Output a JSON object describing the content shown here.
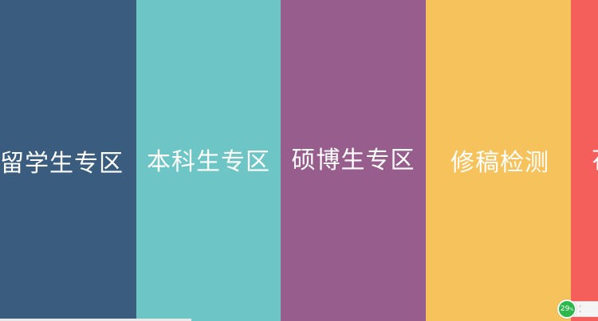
{
  "panels": [
    {
      "label": "留学生专区",
      "color": "#395C7F"
    },
    {
      "label": "本科生专区",
      "color": "#6DC5C5"
    },
    {
      "label": "硕博生专区",
      "color": "#975D8C"
    },
    {
      "label": "修稿检测",
      "color": "#F6C25C"
    },
    {
      "label": "花",
      "color": "#F45F5C"
    }
  ],
  "widget": {
    "value": "29",
    "unit": "%",
    "line1": "↑",
    "line2": "↓",
    "accent": "#2DB84C"
  }
}
